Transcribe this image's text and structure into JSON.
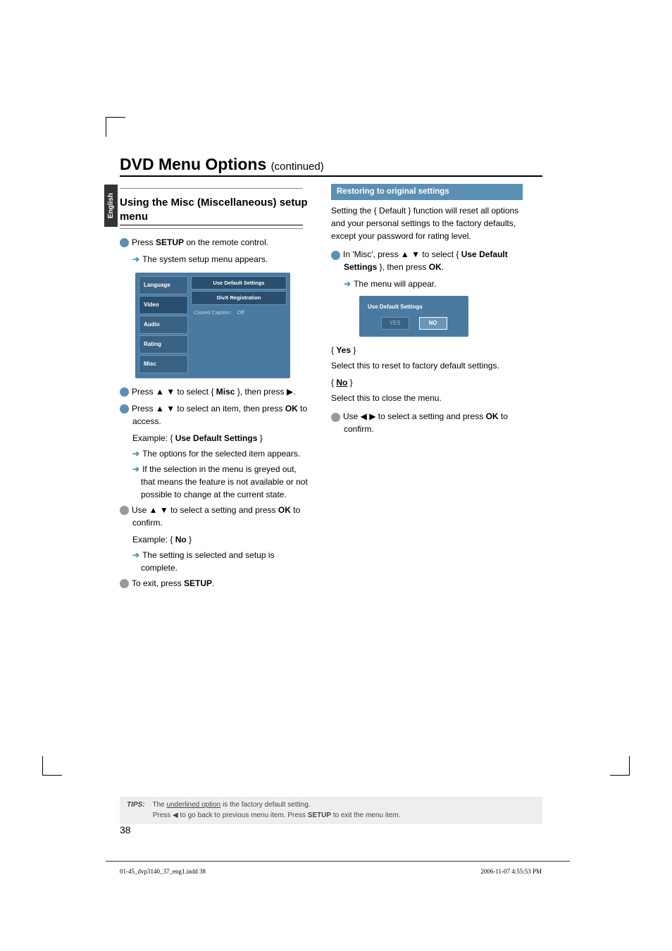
{
  "side_tab": "English",
  "title_main": "DVD Menu Options ",
  "title_sub": "(continued)",
  "left": {
    "heading": "Using the Misc (Miscellaneous) setup menu",
    "step1": "Press ",
    "step1_b": "SETUP",
    "step1_after": " on the remote control.",
    "step1_res": "The system setup menu appears.",
    "menu": {
      "rows": [
        "Language",
        "Video",
        "Audio",
        "Rating",
        "Misc"
      ],
      "right_top1": "Use Default Settings",
      "right_top2": "DivX Registration",
      "right_row_label": "Closed Caption:",
      "right_row_val": "Off"
    },
    "step2_a": "Press ▲ ▼ to select { ",
    "step2_b": "Misc",
    "step2_c": " }, then press ▶.",
    "step3_a": "Press ▲ ▼ to select an item, then press ",
    "step3_b": "OK",
    "step3_c": " to access.",
    "step3_ex_a": "Example: { ",
    "step3_ex_b": "Use Default Settings",
    "step3_ex_c": " }",
    "step3_r1": "The options for the selected item appears.",
    "step3_r2": "If the selection in the menu is greyed out, that means the feature is not available or not possible to change at the current state.",
    "step4_a": "Use ▲ ▼ to select a setting and press ",
    "step4_b": "OK",
    "step4_c": " to confirm.",
    "step4_ex_a": "Example: { ",
    "step4_ex_b": "No",
    "step4_ex_c": " }",
    "step4_r1": "The setting is selected and setup is complete.",
    "step5_a": "To exit, press ",
    "step5_b": "SETUP",
    "step5_c": "."
  },
  "right": {
    "bar": "Restoring to original settings",
    "intro": "Setting the { Default } function will reset all options and your personal settings to the factory defaults, except your password for rating level.",
    "step1_a": "In 'Misc', press ▲ ▼ to select { ",
    "step1_b": "Use Default Settings",
    "step1_c": " }, then press ",
    "step1_d": "OK",
    "step1_e": ".",
    "step1_r": "The menu will appear.",
    "shot_title": "Use Default Settings",
    "shot_yes": "YES",
    "shot_no": "NO",
    "yes_label": "Yes",
    "yes_body": "Select this to reset to factory default settings.",
    "no_label": "No",
    "no_body": "Select this to close the menu.",
    "step2_a": "Use ◀ ▶ to select a setting and press ",
    "step2_b": "OK",
    "step2_c": " to confirm."
  },
  "tips": {
    "label": "TIPS:",
    "line1_a": "The ",
    "line1_b": "underlined option",
    "line1_c": " is the factory default setting.",
    "line2_a": "Press ◀ to go back to previous menu item. Press ",
    "line2_b": "SETUP",
    "line2_c": " to exit the menu item."
  },
  "page_num": "38",
  "footer_src": "01-45_dvp3140_37_eng1.indd   38",
  "footer_date": "2006-11-07   4:55:53 PM"
}
